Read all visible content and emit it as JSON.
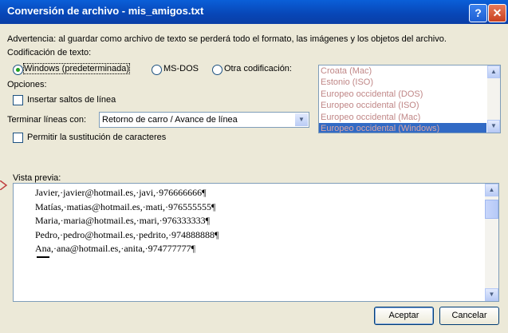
{
  "window": {
    "title": "Conversión de archivo - mis_amigos.txt"
  },
  "warning": "Advertencia: al guardar como archivo de texto se perderá todo el formato, las imágenes y los objetos del archivo.",
  "encoding": {
    "label": "Codificación de texto:",
    "options": [
      {
        "label": "Windows (predeterminada)",
        "selected": true
      },
      {
        "label": "MS-DOS",
        "selected": false
      },
      {
        "label": "Otra codificación:",
        "selected": false
      }
    ],
    "list": [
      "Croata (Mac)",
      "Estonio (ISO)",
      "Europeo occidental (DOS)",
      "Europeo occidental (ISO)",
      "Europeo occidental (Mac)",
      "Europeo occidental (Windows)"
    ],
    "list_selected": "Europeo occidental (Windows)"
  },
  "options": {
    "label": "Opciones:",
    "insert_breaks": "Insertar saltos de línea",
    "end_lines_label": "Terminar líneas con:",
    "end_lines_value": "Retorno de carro / Avance de línea",
    "allow_substitution": "Permitir la sustitución de caracteres"
  },
  "preview": {
    "label": "Vista previa:",
    "lines": [
      "Javier,·javier@hotmail.es,·javi,·976666666¶",
      "Matías,·matias@hotmail.es,·mati,·976555555¶",
      "Maria,·maria@hotmail.es,·mari,·976333333¶",
      "Pedro,·pedro@hotmail.es,·pedrito,·974888888¶",
      "Ana,·ana@hotmail.es,·anita,·974777777¶"
    ]
  },
  "buttons": {
    "accept": "Aceptar",
    "cancel": "Cancelar"
  },
  "colors": {
    "title_bar": "#0a5fd8",
    "selection": "#316ac5",
    "dialog_bg": "#ece9d8"
  }
}
